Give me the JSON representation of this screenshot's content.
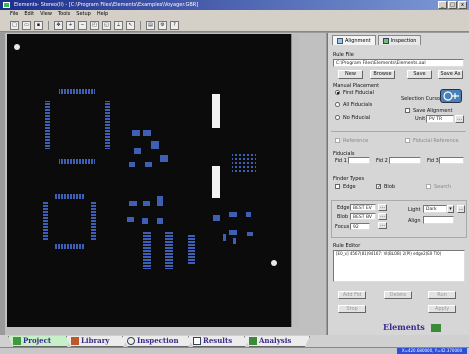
{
  "window": {
    "title": "Elements- Stereo(II) - [C:\\Program Files\\Elements\\Examples\\Voyager.GBR]",
    "buttons": [
      "_",
      "□",
      "x"
    ]
  },
  "menu": [
    "File",
    "Edit",
    "View",
    "Tools",
    "Setup",
    "Help"
  ],
  "toolbar": {
    "icons": [
      "new-icon",
      "open-icon",
      "save-icon",
      "pan-icon",
      "zoom-in-icon",
      "zoom-out-icon",
      "zoom-fit-icon",
      "zoom-window-icon",
      "measure-icon",
      "select-icon",
      "properties-icon",
      "settings-icon",
      "help-icon"
    ]
  },
  "panel": {
    "tabs": [
      {
        "label": "Alignment"
      },
      {
        "label": "Inspection"
      }
    ],
    "rule_file": {
      "label": "Rule File",
      "value": "C:\\Program Files\\Elements\\Elements.aal",
      "buttons": [
        "New",
        "Browse",
        "Save",
        "Save As"
      ]
    },
    "manual_placement": {
      "label": "Manual Placement",
      "options": [
        "First Fiducial",
        "All Fiducials",
        "No Fiducial"
      ],
      "selection_cursor": "Selection Cursor",
      "save_alignment": "Save Alignment",
      "unit_label": "Unit",
      "unit_value": "PV TR"
    },
    "reference": {
      "left": "Reference",
      "right": "Fiducial Reference"
    },
    "fiducials": {
      "label": "Fiducials",
      "items": [
        "Fid 1",
        "Fid 2",
        "Fid 3"
      ]
    },
    "finder_types": {
      "label": "Finder Types",
      "items": [
        "Edge",
        "Blob",
        "Search"
      ]
    },
    "settings": {
      "edge_label": "Edge",
      "edge_value": "BEST EV",
      "blob_label": "Blob",
      "blob_value": "BEST BV",
      "focus_label": "Focus",
      "focus_value": "92",
      "light_label": "Light",
      "light_value": "Dark",
      "align_label": "Align"
    },
    "rule_editor": {
      "label": "Rule Editor",
      "content": "[E0_v] 4567(81)94167: VI(BLOB) 2(PI) edge2(E0 Tl0)"
    },
    "bottom_buttons": [
      "Add Fid",
      "Delete",
      "Run",
      "Stop",
      "Apply"
    ]
  },
  "brand": "Elements",
  "bottom_tabs": [
    {
      "label": "Project",
      "icon": "project-icon"
    },
    {
      "label": "Library",
      "icon": "library-icon"
    },
    {
      "label": "Inspection",
      "icon": "inspection-icon"
    },
    {
      "label": "Results",
      "icon": "results-icon"
    },
    {
      "label": "Analysis",
      "icon": "analysis-icon"
    }
  ],
  "status": {
    "coords": "X=420.680000, Y=42.370000"
  }
}
